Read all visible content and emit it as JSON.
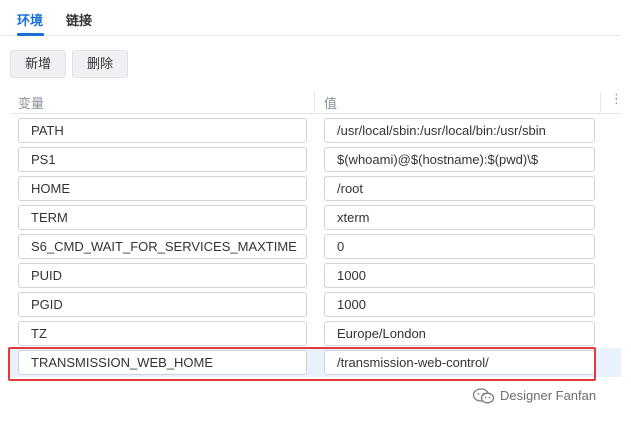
{
  "tabs": [
    {
      "label": "环境",
      "active": true
    },
    {
      "label": "链接",
      "active": false
    }
  ],
  "toolbar": {
    "add_label": "新增",
    "delete_label": "删除"
  },
  "table": {
    "headers": {
      "variable": "变量",
      "value": "值"
    },
    "menu_glyph": "⋮",
    "rows": [
      {
        "key": "PATH",
        "value": "/usr/local/sbin:/usr/local/bin:/usr/sbin"
      },
      {
        "key": "PS1",
        "value": "$(whoami)@$(hostname):$(pwd)\\$"
      },
      {
        "key": "HOME",
        "value": "/root"
      },
      {
        "key": "TERM",
        "value": "xterm"
      },
      {
        "key": "S6_CMD_WAIT_FOR_SERVICES_MAXTIME",
        "value": "0"
      },
      {
        "key": "PUID",
        "value": "1000"
      },
      {
        "key": "PGID",
        "value": "1000"
      },
      {
        "key": "TZ",
        "value": "Europe/London"
      },
      {
        "key": "TRANSMISSION_WEB_HOME",
        "value": "/transmission-web-control/",
        "selected": true
      }
    ]
  },
  "watermark": {
    "text": "Designer Fanfan",
    "icon": "wechat-icon"
  },
  "colors": {
    "accent": "#1a6fd6",
    "highlight_border": "#e23b3b",
    "selected_row": "#e8f1fc"
  }
}
